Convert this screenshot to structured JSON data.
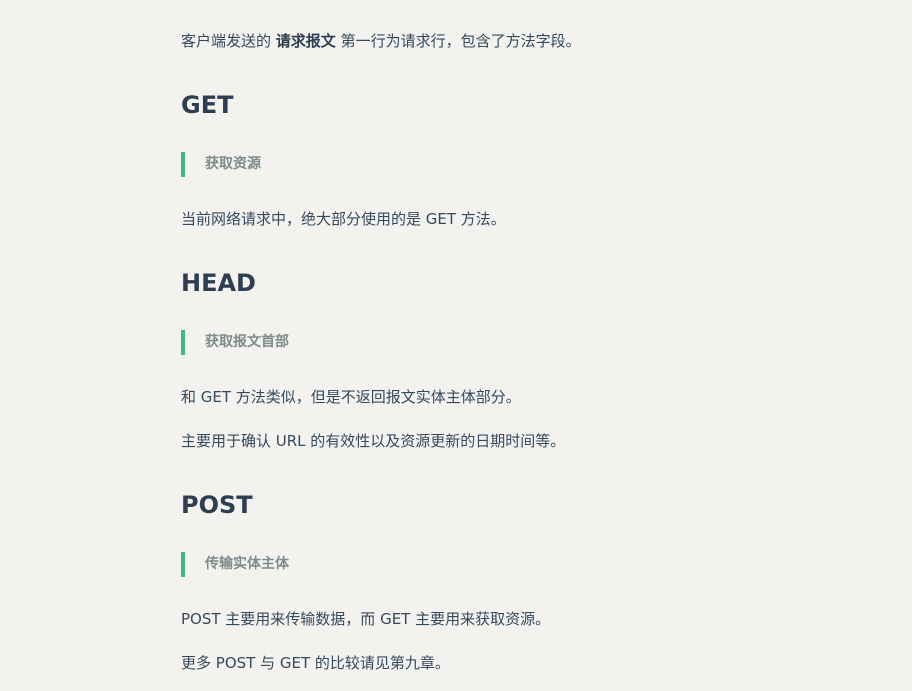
{
  "intro": {
    "before": "客户端发送的 ",
    "bold": "请求报文",
    "after": " 第一行为请求行，包含了方法字段。"
  },
  "sections": [
    {
      "heading": "GET",
      "quote": "获取资源",
      "paragraphs": [
        "当前网络请求中，绝大部分使用的是 GET 方法。"
      ]
    },
    {
      "heading": "HEAD",
      "quote": "获取报文首部",
      "paragraphs": [
        "和 GET 方法类似，但是不返回报文实体主体部分。",
        "主要用于确认 URL 的有效性以及资源更新的日期时间等。"
      ]
    },
    {
      "heading": "POST",
      "quote": "传输实体主体",
      "paragraphs": [
        "POST 主要用来传输数据，而 GET 主要用来获取资源。",
        "更多 POST 与 GET 的比较请见第九章。"
      ]
    }
  ],
  "colors": {
    "background": "#f4f2ef",
    "text": "#34495e",
    "heading": "#2c3e50",
    "quote_bar": "#42b983",
    "quote_text": "#7f8c8d"
  }
}
